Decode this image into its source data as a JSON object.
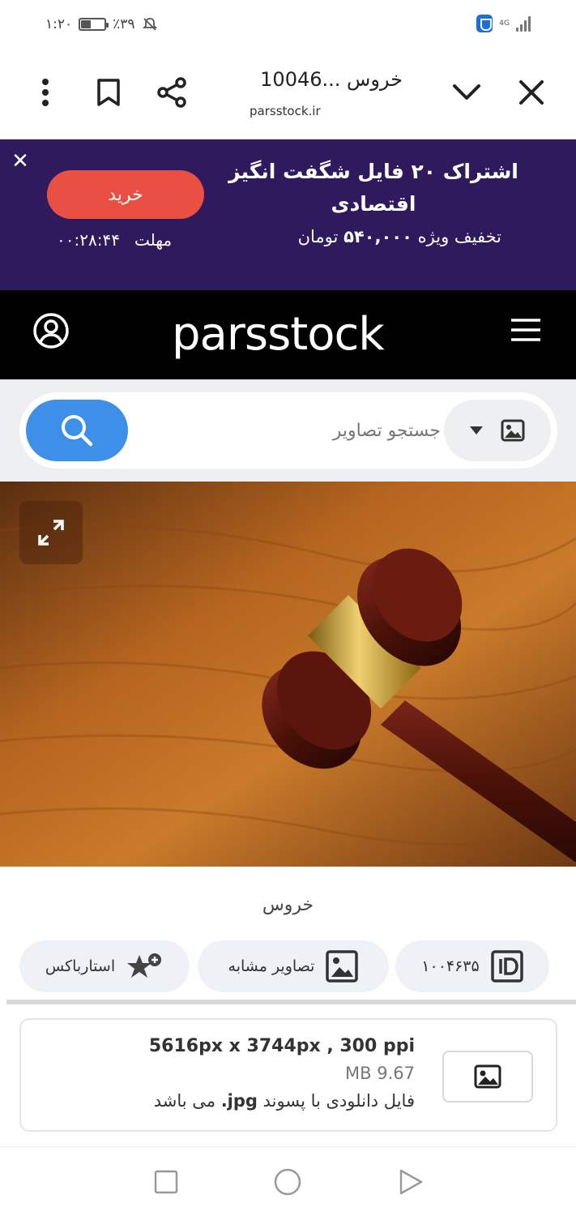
{
  "status_bar": {
    "time": "۱:۲۰",
    "battery_percent": "٪۳۹",
    "battery_level": 0.39,
    "network": "4G"
  },
  "browser": {
    "title": "خروس ...10046",
    "url": "parsstock.ir"
  },
  "promo": {
    "title": "اشتراک ۲۰ فایل شگفت انگیز اقتصادی",
    "buy_label": "خرید",
    "price_prefix": "تخفیف ویژه",
    "price_value": "۵۴۰,۰۰۰",
    "price_unit": "تومان",
    "deadline_label": "مهلت",
    "countdown": "۰۰:۲۸:۴۴"
  },
  "site": {
    "logo": "parsstock"
  },
  "search": {
    "placeholder": "جستجو تصاویر"
  },
  "image": {
    "title": "خروس",
    "id_value": "۱۰۰۴۶۳۵",
    "similar_label": "تصاویر مشابه",
    "starbox_label": "استارباکس"
  },
  "file": {
    "dimensions": "5616px x 3744px , 300 ppi",
    "size": "MB 9.67",
    "ext_text_before": "فایل دانلودی با پسوند",
    "ext_value": "jpg.",
    "ext_text_after": "می باشد"
  },
  "colors": {
    "promo_bg": "#2e1a5d",
    "buy_button": "#ea4f44",
    "search_button": "#3d8fe8",
    "header_bg": "#000000"
  }
}
